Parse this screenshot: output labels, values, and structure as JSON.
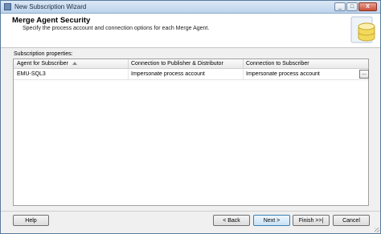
{
  "window": {
    "title": "New Subscription Wizard",
    "minimize_glyph": "_",
    "maximize_glyph": "□",
    "close_glyph": "X"
  },
  "header": {
    "title": "Merge Agent Security",
    "description": "Specify the process account and connection options for each Merge Agent."
  },
  "grid": {
    "label": "Subscription properties:",
    "columns": [
      "Agent for Subscriber",
      "Connection to Publisher & Distributor",
      "Connection to Subscriber"
    ],
    "rows": [
      {
        "agent": "EMU-SQL3",
        "publisher_conn": "Impersonate process account",
        "subscriber_conn": "Impersonate process account",
        "browse_label": "..."
      }
    ]
  },
  "buttons": {
    "help": "Help",
    "back": "< Back",
    "next": "Next >",
    "finish": "Finish >>|",
    "cancel": "Cancel"
  },
  "icons": {
    "app": "wizard-app-icon",
    "header": "database-icon",
    "sort": "sort-ascending-icon"
  },
  "colors": {
    "title_bar": "#c8dbef",
    "close_button": "#c9503a",
    "default_button_border": "#3c7fb1"
  }
}
